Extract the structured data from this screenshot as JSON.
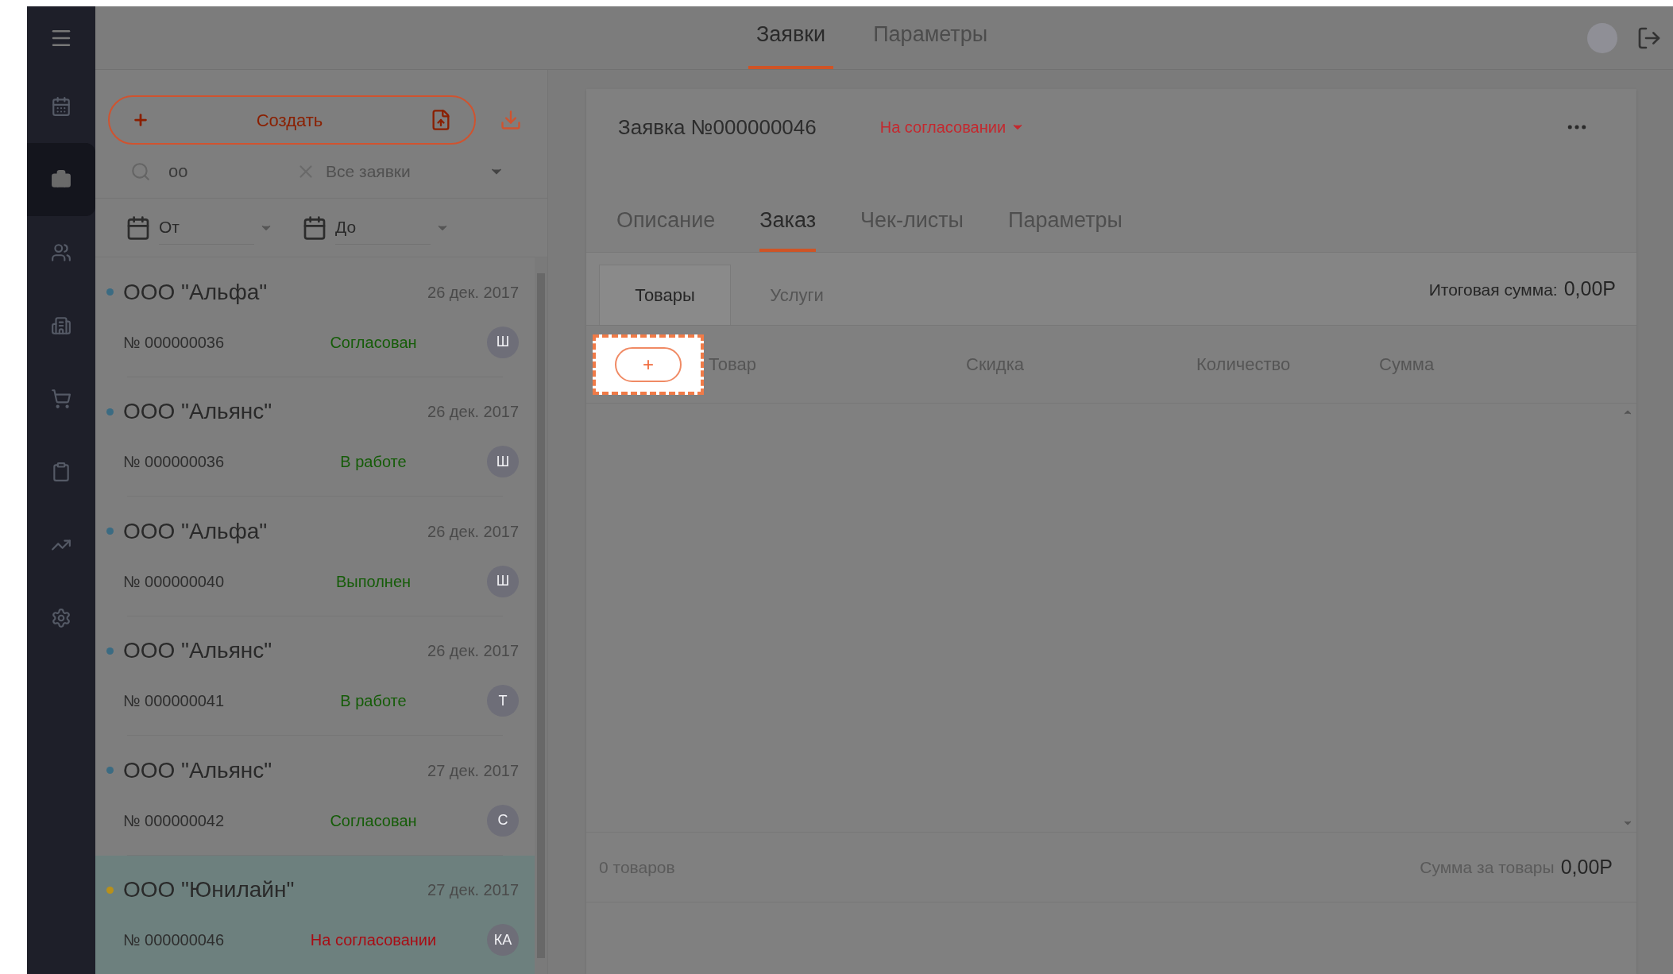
{
  "sidebar": {
    "items": [
      {
        "kind": "calendar",
        "selected": false
      },
      {
        "kind": "briefcase",
        "selected": true
      },
      {
        "kind": "users",
        "selected": false
      },
      {
        "kind": "buildings",
        "selected": false
      },
      {
        "kind": "cart",
        "selected": false
      },
      {
        "kind": "clipboard",
        "selected": false
      },
      {
        "kind": "chart",
        "selected": false
      },
      {
        "kind": "settings",
        "selected": false
      }
    ]
  },
  "top_tabs": [
    {
      "label": "Заявки",
      "selected": true
    },
    {
      "label": "Параметры",
      "selected": false
    }
  ],
  "list_panel": {
    "create_button": "Создать",
    "search": {
      "value": "oo"
    },
    "filter": "Все заявки",
    "date_from": {
      "placeholder": "От"
    },
    "date_to": {
      "placeholder": "До"
    },
    "orders": [
      {
        "company": "ООО \"Альфа\"",
        "date": "26 дек. 2017",
        "number": "№ 000000036",
        "status": {
          "text": "Согласован",
          "color": "#155c08"
        },
        "color": "#3b6b82",
        "avatar": "Ш",
        "selected": false
      },
      {
        "company": "ООО \"Альянс\"",
        "date": "26 дек. 2017",
        "number": "№ 000000036",
        "status": {
          "text": "В работе",
          "color": "#155c08"
        },
        "color": "#3b6b82",
        "avatar": "Ш",
        "selected": false
      },
      {
        "company": "ООО \"Альфа\"",
        "date": "26 дек. 2017",
        "number": "№ 000000040",
        "status": {
          "text": "Выполнен",
          "color": "#155c08"
        },
        "color": "#3b6b82",
        "avatar": "Ш",
        "selected": false
      },
      {
        "company": "ООО \"Альянс\"",
        "date": "26 дек. 2017",
        "number": "№ 000000041",
        "status": {
          "text": "В работе",
          "color": "#155c08"
        },
        "color": "#3b6b82",
        "avatar": "Т",
        "selected": false
      },
      {
        "company": "ООО \"Альянс\"",
        "date": "27 дек. 2017",
        "number": "№ 000000042",
        "status": {
          "text": "Согласован",
          "color": "#155c08"
        },
        "color": "#3b6b82",
        "avatar": "С",
        "selected": false
      },
      {
        "company": "ООО \"Юнилайн\"",
        "date": "27 дек. 2017",
        "number": "№ 000000046",
        "status": {
          "text": "На согласовании",
          "color": "#a80c14"
        },
        "color": "#b8901a",
        "avatar": "КА",
        "selected": true
      }
    ]
  },
  "detail": {
    "title": "Заявка №000000046",
    "status": "На согласовании",
    "tabs": [
      {
        "label": "Описание",
        "selected": false
      },
      {
        "label": "Заказ",
        "selected": true
      },
      {
        "label": "Чек-листы",
        "selected": false
      },
      {
        "label": "Параметры",
        "selected": false
      }
    ],
    "subtabs": [
      {
        "label": "Товары",
        "selected": true
      },
      {
        "label": "Услуги",
        "selected": false
      }
    ],
    "total_label": "Итоговая сумма:",
    "total_value": "0,00Р",
    "add_button": "+",
    "columns": [
      "Товар",
      "Скидка",
      "Количество",
      "Сумма"
    ],
    "footer_count": "0 товаров",
    "footer_sum_label": "Сумма за товары",
    "footer_sum_value": "0,00Р"
  }
}
